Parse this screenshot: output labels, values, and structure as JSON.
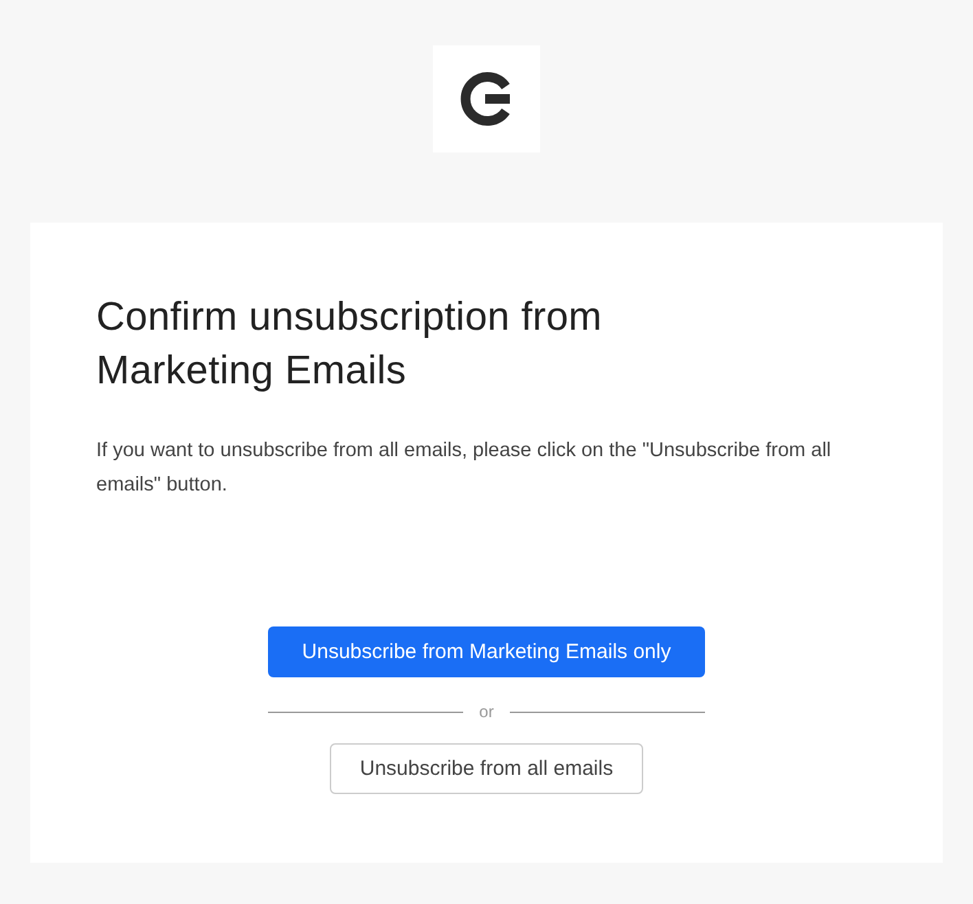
{
  "heading": "Confirm unsubscription from Marketing Emails",
  "description": "If you want to unsubscribe from all emails, please click on the \"Unsubscribe from all emails\" button.",
  "buttons": [
    {
      "label": "Unsubscribe from Marketing Emails only",
      "kind": "primary"
    },
    {
      "label": "or",
      "kind": "divider"
    },
    {
      "label": "Unsubscribe from all emails",
      "kind": "secondary"
    }
  ]
}
